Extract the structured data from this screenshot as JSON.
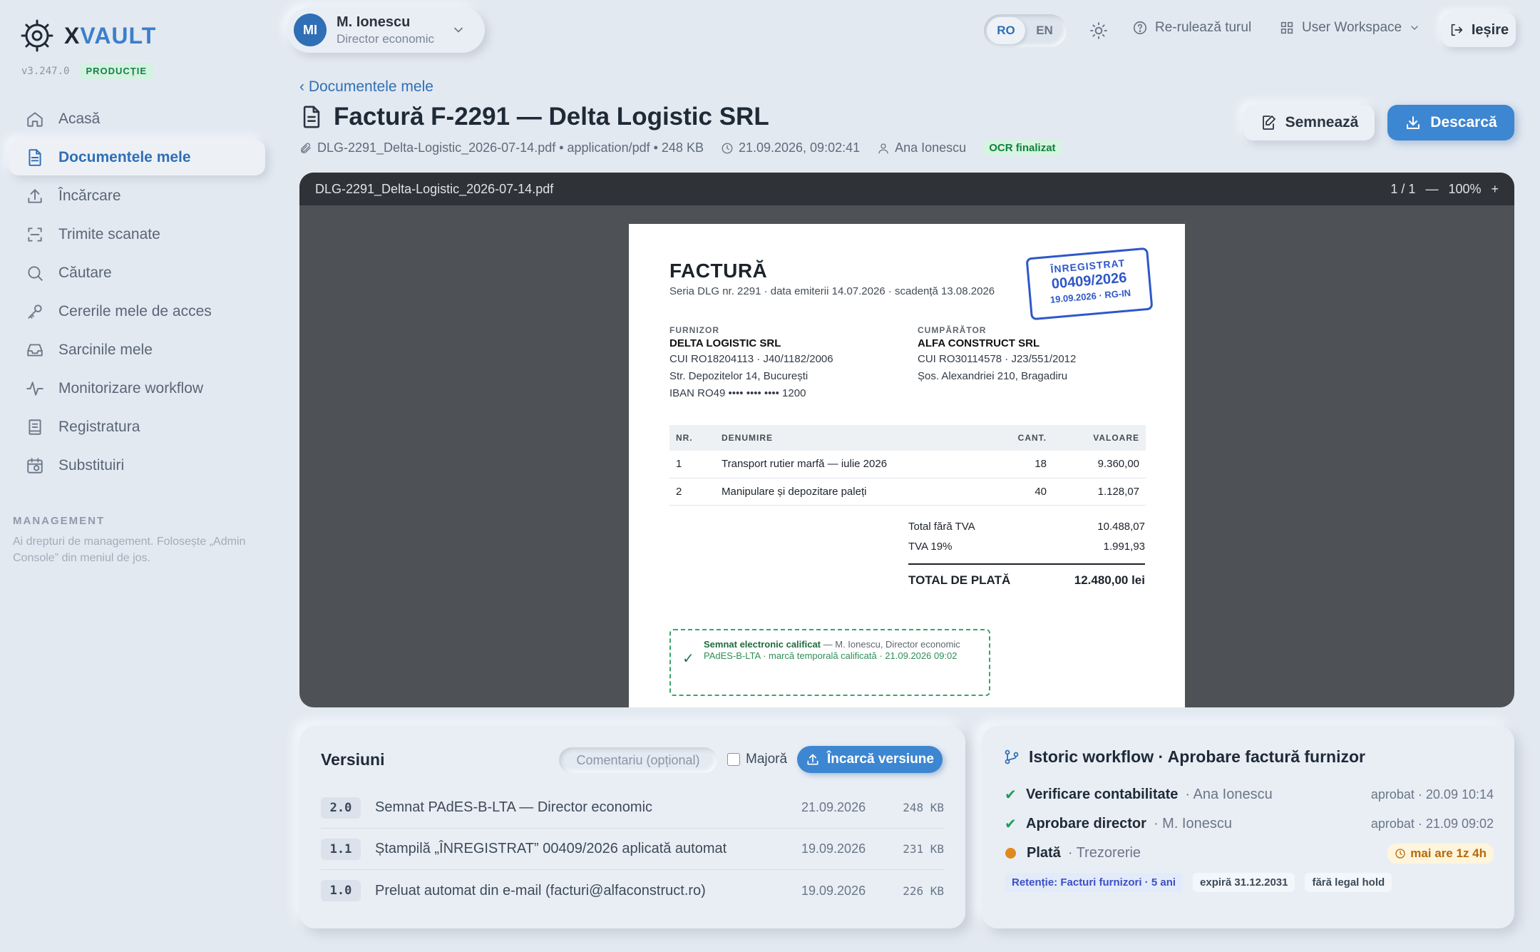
{
  "app": {
    "name_prefix": "X",
    "name_suffix": "VAULT",
    "version": "v3.247.0",
    "environment": "PRODUCȚIE"
  },
  "sidebar": {
    "items": [
      {
        "label": "Acasă",
        "icon": "home-icon"
      },
      {
        "label": "Documentele mele",
        "icon": "document-icon",
        "active": true
      },
      {
        "label": "Încărcare",
        "icon": "upload-icon"
      },
      {
        "label": "Trimite scanate",
        "icon": "scan-icon"
      },
      {
        "label": "Căutare",
        "icon": "search-icon"
      },
      {
        "label": "Cererile mele de acces",
        "icon": "key-icon"
      },
      {
        "label": "Sarcinile mele",
        "icon": "inbox-icon"
      },
      {
        "label": "Monitorizare workflow",
        "icon": "activity-icon"
      },
      {
        "label": "Registratura",
        "icon": "register-icon"
      },
      {
        "label": "Substituiri",
        "icon": "calendar-swap-icon"
      }
    ],
    "management_title": "MANAGEMENT",
    "management_note": "Ai drepturi de management. Folosește „Admin Console” din meniul de jos."
  },
  "user": {
    "initials": "MI",
    "name": "M. Ionescu",
    "role": "Director economic"
  },
  "topbar": {
    "lang_ro": "RO",
    "lang_en": "EN",
    "tour_label": "Re-rulează turul",
    "workspace_label": "User Workspace",
    "logout_label": "Ieșire"
  },
  "header": {
    "back_label": "‹ Documentele mele",
    "title": "Factură F-2291 — Delta Logistic SRL",
    "file_info": "DLG-2291_Delta-Logistic_2026-07-14.pdf • application/pdf • 248 KB",
    "timestamp": "21.09.2026, 09:02:41",
    "owner": "Ana Ionescu",
    "ocr_status": "OCR finalizat",
    "sign_label": "Semnează",
    "download_label": "Descarcă"
  },
  "viewer": {
    "filename": "DLG-2291_Delta-Logistic_2026-07-14.pdf",
    "page_indicator": "1 / 1",
    "zoom_out": "—",
    "zoom": "100%",
    "zoom_in": "+"
  },
  "invoice": {
    "title": "FACTURĂ",
    "subtitle": "Seria DLG nr. 2291 · data emiterii 14.07.2026 · scadență 13.08.2026",
    "stamp": {
      "line1": "ÎNREGISTRAT",
      "line2": "00409/2026",
      "line3": "19.09.2026 · RG-IN"
    },
    "supplier": {
      "label": "FURNIZOR",
      "name": "DELTA LOGISTIC SRL",
      "line1": "CUI RO18204113 · J40/1182/2006",
      "line2": "Str. Depozitelor 14, București",
      "line3": "IBAN RO49 •••• •••• •••• 1200"
    },
    "buyer": {
      "label": "CUMPĂRĂTOR",
      "name": "ALFA CONSTRUCT SRL",
      "line1": "CUI RO30114578 · J23/551/2012",
      "line2": "Șos. Alexandriei 210, Bragadiru"
    },
    "columns": {
      "nr": "NR.",
      "name": "DENUMIRE",
      "qty": "CANT.",
      "value": "VALOARE"
    },
    "rows": [
      {
        "nr": "1",
        "name": "Transport rutier marfă — iulie 2026",
        "qty": "18",
        "value": "9.360,00"
      },
      {
        "nr": "2",
        "name": "Manipulare și depozitare paleți",
        "qty": "40",
        "value": "1.128,07"
      }
    ],
    "totals": {
      "net_label": "Total fără TVA",
      "net": "10.488,07",
      "vat_label": "TVA 19%",
      "vat": "1.991,93",
      "grand_label": "TOTAL DE PLATĂ",
      "grand": "12.480,00 lei"
    },
    "signature": {
      "title": "Semnat electronic calificat",
      "who": " — M. Ionescu, Director economic",
      "detail": "PAdES-B-LTA · marcă temporală calificată · 21.09.2026 09:02"
    }
  },
  "versions": {
    "title": "Versiuni",
    "comment_placeholder": "Comentariu (opțional)",
    "major_label": "Majoră",
    "upload_label": "Încarcă versiune",
    "items": [
      {
        "tag": "2.0",
        "desc": "Semnat PAdES-B-LTA — Director economic",
        "date": "21.09.2026",
        "size": "248 KB"
      },
      {
        "tag": "1.1",
        "desc": "Ștampilă „ÎNREGISTRAT” 00409/2026 aplicată automat",
        "date": "19.09.2026",
        "size": "231 KB"
      },
      {
        "tag": "1.0",
        "desc": "Preluat automat din e-mail (facturi@alfaconstruct.ro)",
        "date": "19.09.2026",
        "size": "226 KB"
      }
    ]
  },
  "workflow": {
    "title": "Istoric workflow · Aprobare factură furnizor",
    "steps": [
      {
        "mark": "✔",
        "step": "Verificare contabilitate",
        "who": "· Ana Ionescu",
        "status": "aprobat · 20.09 10:14"
      },
      {
        "mark": "✔",
        "step": "Aprobare director",
        "who": "· M. Ionescu",
        "status": "aprobat · 21.09 09:02"
      },
      {
        "step": "Plată",
        "who": "· Trezorerie",
        "pending": "mai are 1z 4h"
      }
    ],
    "retention": "Retenție: Facturi furnizori · 5 ani",
    "expires": "expiră 31.12.2031",
    "legal_hold": "fără legal hold"
  },
  "colors": {
    "accent": "#2f6fb5",
    "primary_button": "#3d86d1",
    "success": "#1f9d55",
    "pending": "#e08a1e",
    "stamp": "#2f57c8"
  }
}
